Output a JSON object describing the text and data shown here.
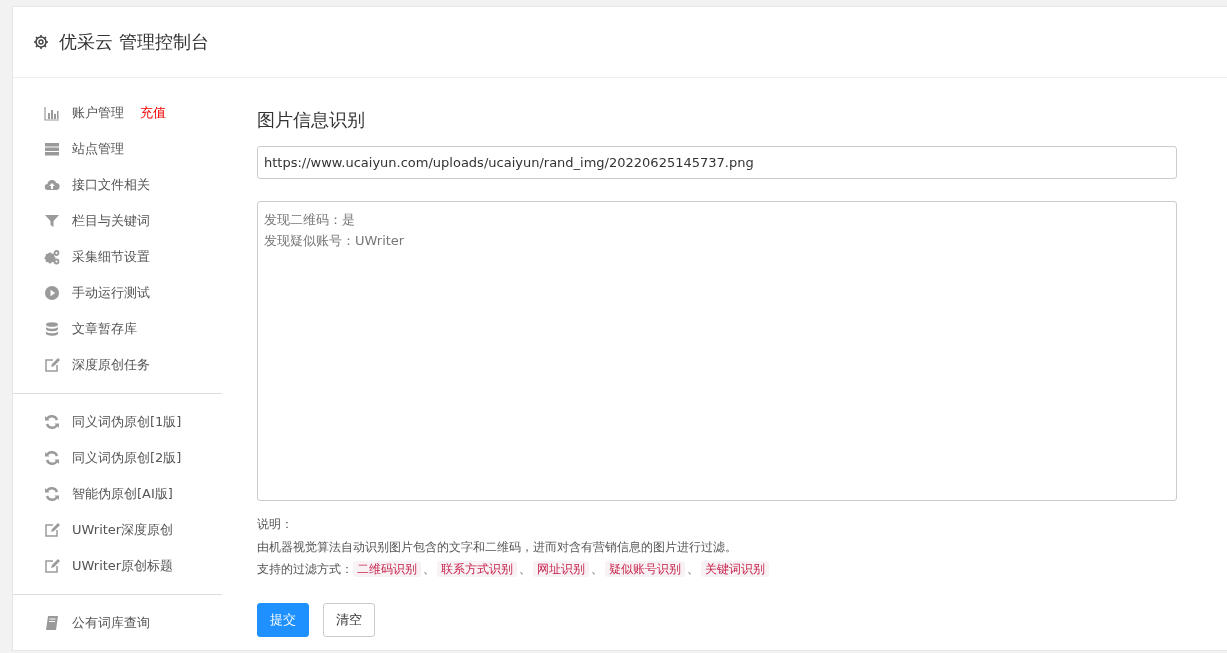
{
  "header": {
    "title": "优采云 管理控制台"
  },
  "sidebar": {
    "groups": [
      {
        "items": [
          {
            "label": "账户管理",
            "badge": "充值"
          },
          {
            "label": "站点管理"
          },
          {
            "label": "接口文件相关"
          },
          {
            "label": "栏目与关键词"
          },
          {
            "label": "采集细节设置"
          },
          {
            "label": "手动运行测试"
          },
          {
            "label": "文章暂存库"
          },
          {
            "label": "深度原创任务"
          }
        ]
      },
      {
        "items": [
          {
            "label": "同义词伪原创[1版]"
          },
          {
            "label": "同义词伪原创[2版]"
          },
          {
            "label": "智能伪原创[AI版]"
          },
          {
            "label": "UWriter深度原创"
          },
          {
            "label": "UWriter原创标题"
          }
        ]
      },
      {
        "items": [
          {
            "label": "公有词库查询"
          }
        ]
      }
    ]
  },
  "main": {
    "title": "图片信息识别",
    "url_field": {
      "value": "https://www.ucaiyun.com/uploads/ucaiyun/rand_img/20220625145737.png"
    },
    "result": {
      "lines": [
        "发现二维码：是",
        "发现疑似账号：UWriter"
      ]
    },
    "notes_label": "说明：",
    "description": "由机器视觉算法自动识别图片包含的文字和二维码，进而对含有营销信息的图片进行过滤。",
    "filters_label": "支持的过滤方式：",
    "filters": [
      "二维码识别",
      "联系方式识别",
      "网址识别",
      "疑似账号识别",
      "关键词识别"
    ],
    "separator": "、",
    "buttons": [
      {
        "label": "提交",
        "kind": "primary"
      },
      {
        "label": "清空",
        "kind": "default"
      }
    ]
  }
}
